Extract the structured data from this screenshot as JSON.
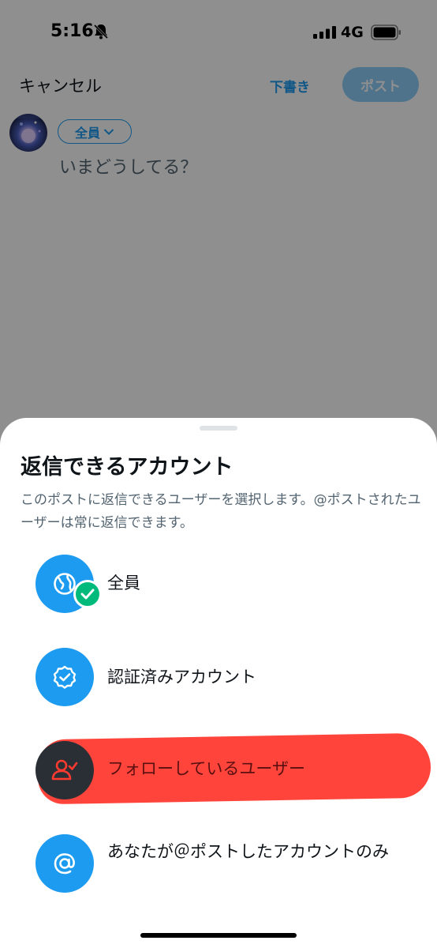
{
  "status_bar": {
    "time": "5:16",
    "network": "4G"
  },
  "composer": {
    "cancel_label": "キャンセル",
    "drafts_label": "下書き",
    "post_label": "ポスト",
    "audience_label": "全員",
    "placeholder": "いまどうしてる？"
  },
  "sheet": {
    "title": "返信できるアカウント",
    "description": "このポストに返信できるユーザーを選択します。@ポストされたユーザーは常に返信できます。",
    "options": [
      {
        "label": "全員",
        "icon": "globe-icon",
        "selected": true
      },
      {
        "label": "認証済みアカウント",
        "icon": "verified-badge-icon",
        "selected": false
      },
      {
        "label": "フォローしているユーザー",
        "icon": "person-check-icon",
        "selected": false
      },
      {
        "label": "あなたが＠ポストしたアカウントのみ",
        "icon": "at-sign-icon",
        "selected": false
      }
    ]
  },
  "colors": {
    "accent": "#1d9bf0",
    "success": "#00ba7c",
    "annotation_red": "#ff3b30",
    "text_primary": "#0f1419",
    "text_secondary": "#536471"
  }
}
